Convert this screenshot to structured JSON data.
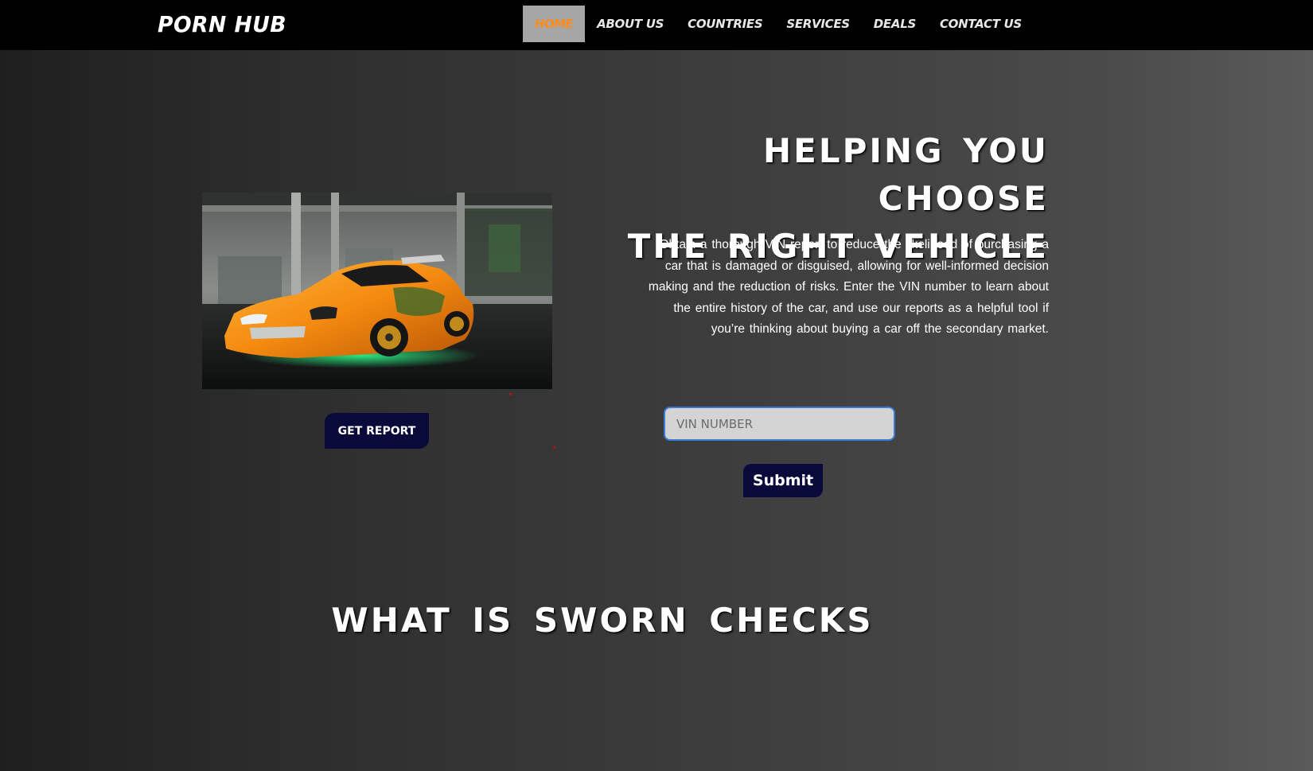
{
  "header": {
    "brand": "PORN HUB",
    "nav": [
      {
        "label": "HOME",
        "active": true
      },
      {
        "label": "ABOUT US",
        "active": false
      },
      {
        "label": "COUNTRIES",
        "active": false
      },
      {
        "label": "SERVICES",
        "active": false
      },
      {
        "label": "DEALS",
        "active": false
      },
      {
        "label": "CONTACT US",
        "active": false
      }
    ]
  },
  "hero": {
    "title_line1": "HELPING YOU CHOOSE",
    "title_line2": "THE RIGHT VEHICLE",
    "description": "Obtain a thorough VIN report to reduce the likelihood of purchasing a car that is damaged or disguised, allowing for well-informed decision making and the reduction of risks. Enter the VIN number to learn about the entire history of the car, and use our reports as a helpful tool if you’re thinking about buying a car off the secondary market.",
    "get_report_label": "GET REPORT",
    "vin_placeholder": "VIN NUMBER",
    "submit_label": "Submit"
  },
  "section": {
    "title": "WHAT IS SWORN CHECKS"
  },
  "colors": {
    "nav_active_text": "#ff8c1a",
    "nav_active_bg": "#a6a6a6",
    "button_bg": "#0a0a3a",
    "input_border": "#3a7bd5"
  }
}
